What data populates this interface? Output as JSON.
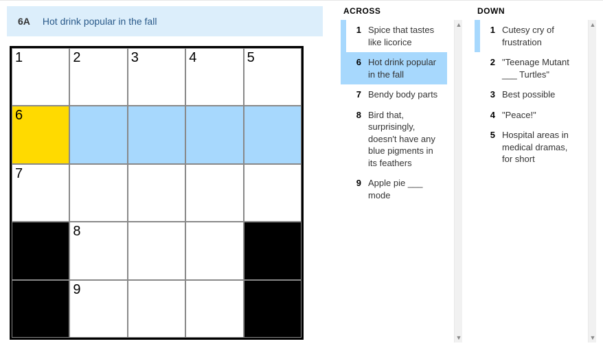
{
  "current_clue": {
    "label": "6A",
    "text": "Hot drink popular in the fall"
  },
  "grid": {
    "size": 5,
    "cells": [
      {
        "r": 0,
        "c": 0,
        "num": "1"
      },
      {
        "r": 0,
        "c": 1,
        "num": "2"
      },
      {
        "r": 0,
        "c": 2,
        "num": "3"
      },
      {
        "r": 0,
        "c": 3,
        "num": "4"
      },
      {
        "r": 0,
        "c": 4,
        "num": "5"
      },
      {
        "r": 1,
        "c": 0,
        "num": "6",
        "focus": true
      },
      {
        "r": 1,
        "c": 1,
        "hl": true
      },
      {
        "r": 1,
        "c": 2,
        "hl": true
      },
      {
        "r": 1,
        "c": 3,
        "hl": true
      },
      {
        "r": 1,
        "c": 4,
        "hl": true
      },
      {
        "r": 2,
        "c": 0,
        "num": "7"
      },
      {
        "r": 2,
        "c": 1
      },
      {
        "r": 2,
        "c": 2
      },
      {
        "r": 2,
        "c": 3
      },
      {
        "r": 2,
        "c": 4
      },
      {
        "r": 3,
        "c": 0,
        "black": true
      },
      {
        "r": 3,
        "c": 1,
        "num": "8"
      },
      {
        "r": 3,
        "c": 2
      },
      {
        "r": 3,
        "c": 3
      },
      {
        "r": 3,
        "c": 4,
        "black": true
      },
      {
        "r": 4,
        "c": 0,
        "black": true
      },
      {
        "r": 4,
        "c": 1,
        "num": "9"
      },
      {
        "r": 4,
        "c": 2
      },
      {
        "r": 4,
        "c": 3
      },
      {
        "r": 4,
        "c": 4,
        "black": true
      }
    ]
  },
  "clues": {
    "across_title": "ACROSS",
    "down_title": "DOWN",
    "across": [
      {
        "num": "1",
        "text": "Spice that tastes like licorice",
        "related": true
      },
      {
        "num": "6",
        "text": "Hot drink popular in the fall",
        "selected": true
      },
      {
        "num": "7",
        "text": "Bendy body parts"
      },
      {
        "num": "8",
        "text": "Bird that, surprisingly, doesn't have any blue pigments in its feathers"
      },
      {
        "num": "9",
        "text": "Apple pie ___ mode"
      }
    ],
    "down": [
      {
        "num": "1",
        "text": "Cutesy cry of frustration",
        "related": true
      },
      {
        "num": "2",
        "text": "\"Teenage Mutant ___ Turtles\""
      },
      {
        "num": "3",
        "text": "Best possible"
      },
      {
        "num": "4",
        "text": "\"Peace!\""
      },
      {
        "num": "5",
        "text": "Hospital areas in medical dramas, for short"
      }
    ]
  }
}
